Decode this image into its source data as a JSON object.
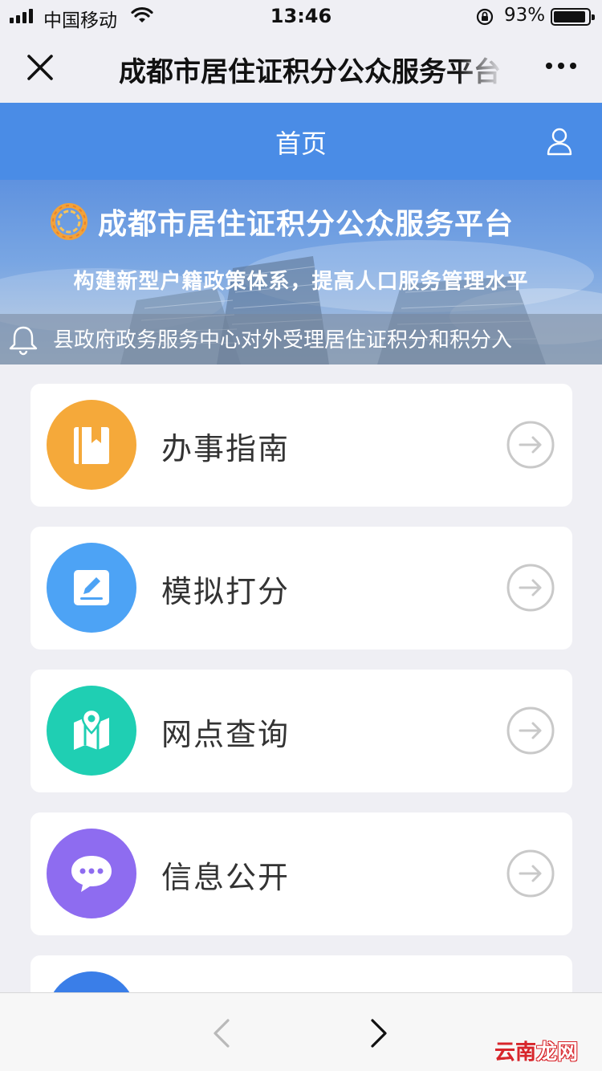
{
  "status_bar": {
    "carrier": "中国移动",
    "time": "13:46",
    "battery_percent": "93%",
    "battery_level": 0.93
  },
  "nav": {
    "close_icon": "close-icon",
    "title": "成都市居住证积分公众服务平台",
    "more_icon": "more-dots-icon"
  },
  "header": {
    "title": "首页",
    "user_icon": "user-icon",
    "background_color": "#4a8ce6"
  },
  "banner": {
    "title": "成都市居住证积分公众服务平台",
    "subtitle": "构建新型户籍政策体系，提高人口服务管理水平",
    "notice": "县政府政务服务中心对外受理居住证积分和积分入"
  },
  "menu": [
    {
      "label": "办事指南",
      "icon": "book-icon",
      "color": "#f5a93a"
    },
    {
      "label": "模拟打分",
      "icon": "edit-icon",
      "color": "#4da3f5"
    },
    {
      "label": "网点查询",
      "icon": "map-pin-icon",
      "color": "#1fcfb3"
    },
    {
      "label": "信息公开",
      "icon": "chat-bubble-icon",
      "color": "#8e6cf0"
    },
    {
      "label": "",
      "icon": "partial-icon",
      "color": "#3a7ee8"
    }
  ],
  "toolbar": {
    "back_icon": "back-arrow-icon",
    "forward_icon": "forward-arrow-icon"
  },
  "watermark": {
    "part1": "云南",
    "part2": "龙网"
  }
}
